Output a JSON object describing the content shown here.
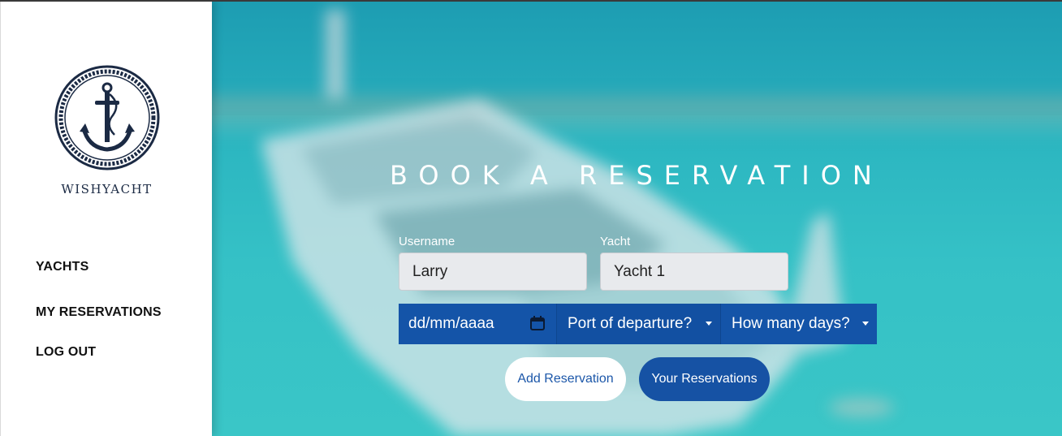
{
  "brand": {
    "name": "WISHYACHT",
    "logo_icon": "anchor-rope-logo"
  },
  "nav": {
    "items": [
      {
        "label": "YACHTS"
      },
      {
        "label": "MY RESERVATIONS"
      },
      {
        "label": "LOG OUT"
      }
    ]
  },
  "hero": {
    "title": "BOOK A RESERVATION",
    "background": "blurred-yacht-photo"
  },
  "form": {
    "username": {
      "label": "Username",
      "value": "Larry"
    },
    "yacht": {
      "label": "Yacht",
      "value": "Yacht 1"
    },
    "date": {
      "placeholder": "dd/mm/aaaa",
      "icon": "calendar-icon"
    },
    "port": {
      "selected": "Port of departure?"
    },
    "days": {
      "selected": "How many days?"
    },
    "buttons": {
      "add": "Add Reservation",
      "yours": "Your Reservations"
    }
  },
  "colors": {
    "accent": "#1454a8",
    "sea": "#2bb5c0",
    "sidebar_bg": "#ffffff",
    "brand_text": "#1b2a44"
  }
}
